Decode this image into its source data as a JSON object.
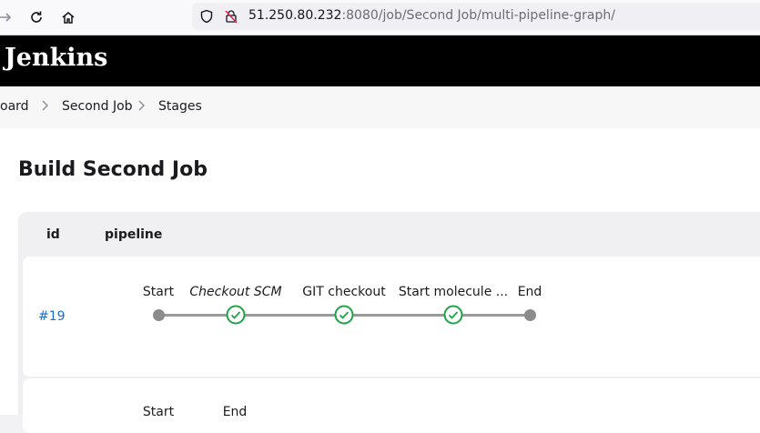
{
  "browser": {
    "url_host": "51.250.80.232",
    "url_path": ":8080/job/Second Job/multi-pipeline-graph/",
    "icons": [
      "forward-arrow-icon",
      "reload-icon",
      "home-icon",
      "shield-icon",
      "insecure-lock-icon"
    ]
  },
  "header": {
    "logo": "Jenkins"
  },
  "breadcrumb": {
    "items": [
      "oard",
      "Second Job",
      "Stages"
    ],
    "separator": ">"
  },
  "page": {
    "title": "Build Second Job"
  },
  "table": {
    "headers": {
      "id": "id",
      "pipeline": "pipeline"
    },
    "runs": [
      {
        "id": "#19",
        "stages": [
          {
            "label": "Start",
            "status": "start"
          },
          {
            "label": "Checkout SCM",
            "status": "success"
          },
          {
            "label": "GIT checkout",
            "status": "success"
          },
          {
            "label": "Start molecule ...",
            "status": "success"
          },
          {
            "label": "End",
            "status": "end"
          }
        ]
      },
      {
        "id": "",
        "stages": [
          {
            "label": "Start",
            "status": "start"
          },
          {
            "label": "End",
            "status": "end"
          }
        ]
      }
    ]
  },
  "colors": {
    "accent": "#1a6dc8",
    "success": "#1ea446",
    "node": "#8b8b8b"
  }
}
